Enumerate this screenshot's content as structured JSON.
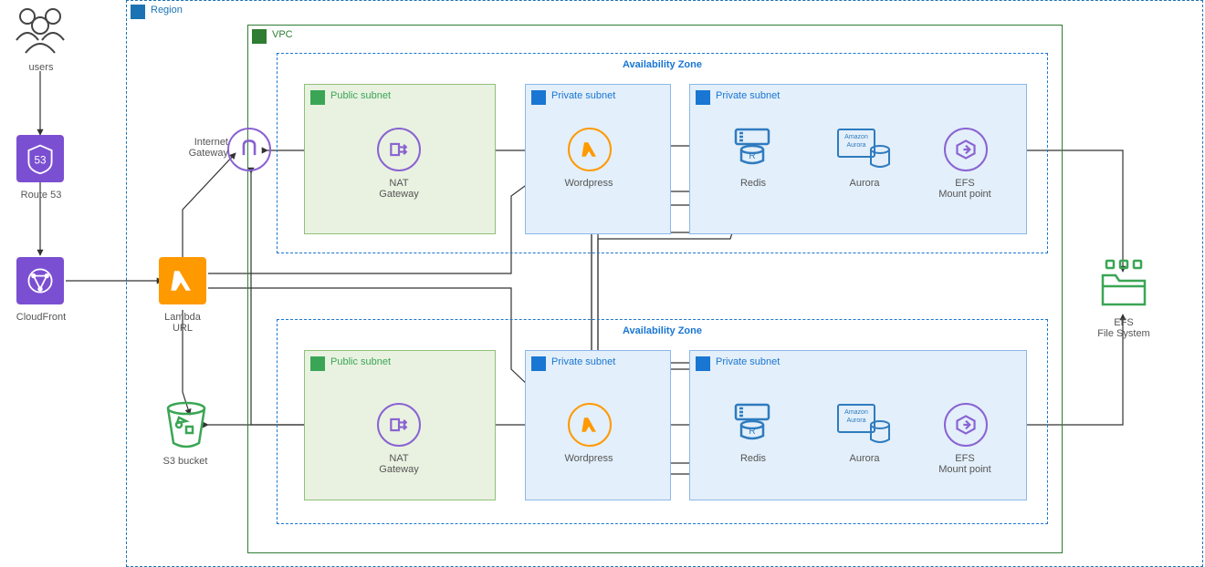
{
  "region_label": "Region",
  "vpc_label": "VPC",
  "az_label": "Availability Zone",
  "public_subnet": "Public subnet",
  "private_subnet": "Private subnet",
  "users": "users",
  "route53": "Route 53",
  "cloudfront": "CloudFront",
  "lambda_url": "Lambda\nURL",
  "s3_bucket": "S3 bucket",
  "internet_gateway": "Internet\nGateway",
  "nat_gateway": "NAT\nGateway",
  "wordpress": "Wordpress",
  "redis": "Redis",
  "amazon_aurora": "Amazon\nAurora",
  "aurora": "Aurora",
  "efs_mount": "EFS\nMount point",
  "efs_fs": "EFS\nFile System",
  "colors": {
    "region_border": "#1b73b3",
    "vpc_border": "#2e7d32",
    "az_border": "#1976d2",
    "public_fill": "#e9f2e1",
    "public_border": "#8fc07a",
    "private_fill": "#e3effa",
    "private_border": "#8cb8e8",
    "orange": "#ff9900",
    "blue": "#2f7bbf",
    "purple": "#8a63d2",
    "green": "#3aa655"
  }
}
